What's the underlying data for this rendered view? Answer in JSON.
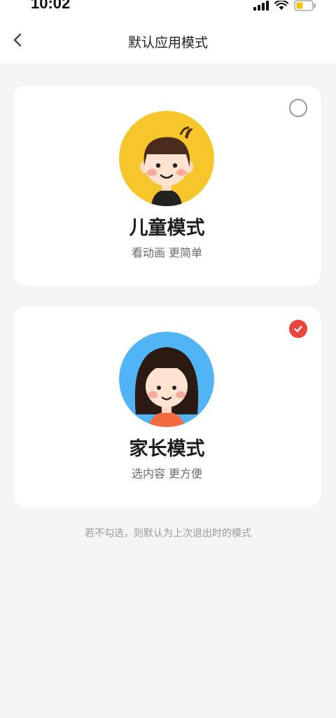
{
  "status_bar": {
    "time": "10:02",
    "icons": [
      "signal-icon",
      "wifi-icon",
      "battery-icon"
    ]
  },
  "header": {
    "title": "默认应用模式",
    "back_icon": "back-arrow-icon"
  },
  "modes": [
    {
      "title": "儿童模式",
      "subtitle": "看动画 更简单",
      "selected": false,
      "avatar": "boy-avatar-yellow",
      "avatar_bg": "#f7c62b"
    },
    {
      "title": "家长模式",
      "subtitle": "选内容 更方便",
      "selected": true,
      "avatar": "girl-avatar-blue",
      "avatar_bg": "#51b4f5"
    }
  ],
  "hint": "若不勾选，则默认为上次退出时的模式",
  "colors": {
    "accent": "#e8453c",
    "background": "#f5f5f5",
    "card": "#ffffff"
  }
}
